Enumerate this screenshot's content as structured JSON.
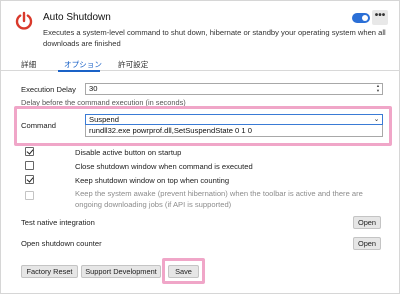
{
  "header": {
    "title": "Auto Shutdown",
    "description": "Executes a system-level command to shut down, hibernate or standby your operating system when all downloads are finished",
    "accent": "#d9392b",
    "toggle_on": true,
    "toggle_color": "#2b6fd6",
    "menu_label": "•••"
  },
  "tabs": [
    {
      "label": "詳細",
      "active": false
    },
    {
      "label": "オプション",
      "active": true
    },
    {
      "label": "許可設定",
      "active": false
    }
  ],
  "execution_delay": {
    "label": "Execution Delay",
    "value": "30",
    "hint": "Delay before the command execution (in seconds)"
  },
  "command": {
    "label": "Command",
    "selected": "Suspend",
    "dropdown_option": "rundll32.exe powrprof.dll,SetSuspendState 0 1 0"
  },
  "checkboxes": [
    {
      "label": "Disable active button on startup",
      "checked": true,
      "disabled": false
    },
    {
      "label": "Close shutdown window when command is executed",
      "checked": false,
      "disabled": false
    },
    {
      "label": "Keep shutdown window on top when counting",
      "checked": true,
      "disabled": false
    },
    {
      "label": "Keep the system awake (prevent hibernation) when the toolbar is active and there are ongoing downloading jobs (if API is supported)",
      "checked": false,
      "disabled": true
    }
  ],
  "actions": {
    "test_native_label": "Test native integration",
    "open_counter_label": "Open shutdown counter",
    "open_button": "Open"
  },
  "footer": {
    "factory_reset": "Factory Reset",
    "support_development": "Support Development",
    "save": "Save"
  },
  "highlight_color": "#f0a6c8"
}
